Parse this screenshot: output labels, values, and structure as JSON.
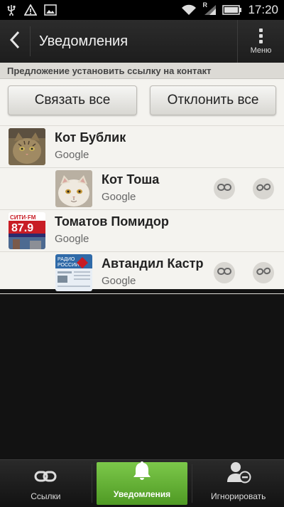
{
  "status_bar": {
    "time": "17:20",
    "network_letter": "R",
    "icons": [
      "usb-icon",
      "warning-icon",
      "image-icon",
      "wifi-icon",
      "signal-icon",
      "battery-icon"
    ]
  },
  "action_bar": {
    "title": "Уведомления",
    "menu_label": "Меню"
  },
  "section": {
    "header": "Предложение установить ссылку на контакт"
  },
  "buttons": {
    "link_all": "Связать все",
    "decline_all": "Отклонить все"
  },
  "contacts": [
    {
      "name": "Кот Бублик",
      "account": "Google",
      "level": 1,
      "avatar": "cat-photo"
    },
    {
      "name": "Кот Тоша",
      "account": "Google",
      "level": 2,
      "avatar": "cat-photo"
    },
    {
      "name": "Томатов Помидор",
      "account": "Google",
      "level": 1,
      "avatar": "radio-logo"
    },
    {
      "name": "Автандил Кастр",
      "account": "Google",
      "level": 2,
      "avatar": "website-thumbnail"
    }
  ],
  "avatar_text": {
    "radio_line1": "СИТИ·FM",
    "radio_line2": "87.9",
    "site_line1": "РАДИО",
    "site_line2": "РОССИИ"
  },
  "bottom_nav": {
    "tabs": [
      {
        "label": "Ссылки",
        "icon": "link-icon",
        "active": false
      },
      {
        "label": "Уведомления",
        "icon": "bell-icon",
        "active": true
      },
      {
        "label": "Игнорировать",
        "icon": "person-ignore-icon",
        "active": false
      }
    ]
  },
  "colors": {
    "accent_green": "#6cbf3c",
    "background": "#121212",
    "list_background": "#f4f3ef"
  }
}
